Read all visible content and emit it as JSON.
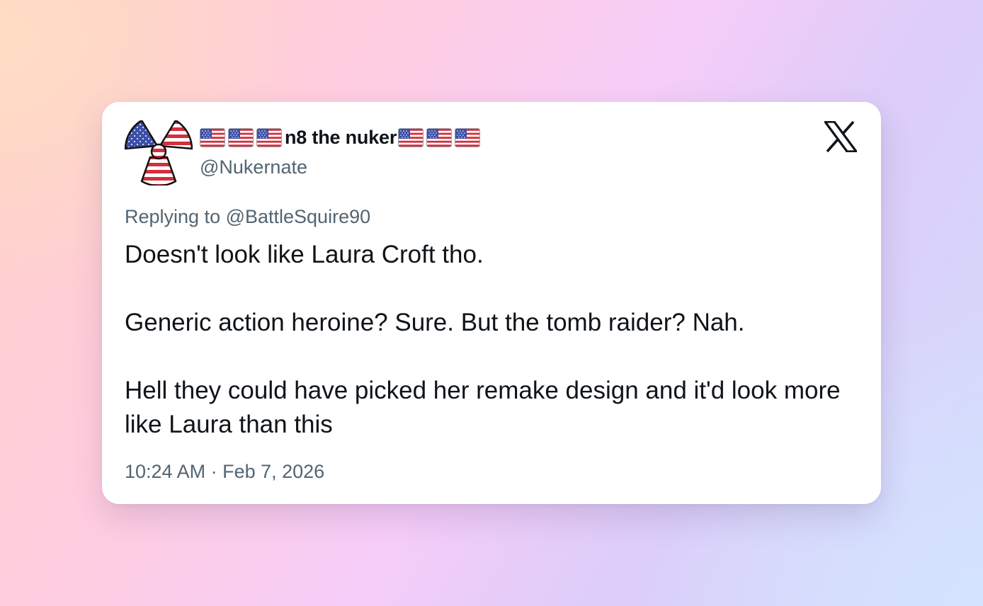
{
  "tweet": {
    "display_name": "n8 the nuker",
    "name_prefix_flags": [
      "us-flag-emoji",
      "us-flag-emoji",
      "us-flag-emoji"
    ],
    "name_suffix_flags": [
      "us-flag-emoji",
      "us-flag-emoji",
      "us-flag-emoji"
    ],
    "handle": "@Nukernate",
    "avatar_icon": "radiation-trefoil-us-flag-icon",
    "platform_icon": "x-logo-icon",
    "replying_to": "Replying to @BattleSquire90",
    "body": [
      "Doesn't look like Laura Croft tho.",
      "Generic action heroine? Sure. But the tomb raider? Nah.",
      "Hell they could have picked her remake design and it'd look more like Laura than this"
    ],
    "timestamp": "10:24 AM · Feb 7, 2026"
  },
  "colors": {
    "text_primary": "#0f1419",
    "text_secondary": "#536471",
    "card_background": "#ffffff",
    "flag_red": "#d22f3c",
    "flag_blue": "#3c4fa8"
  }
}
